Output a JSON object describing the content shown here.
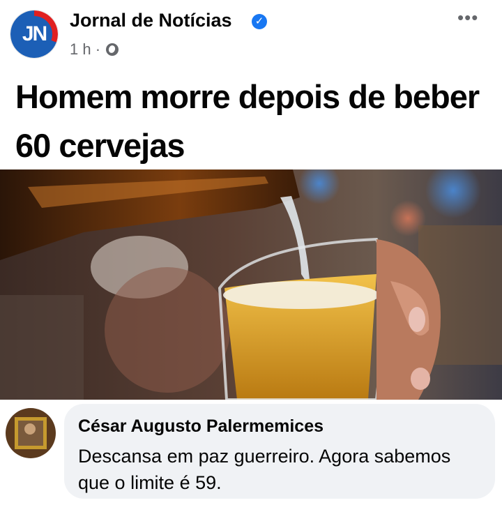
{
  "post": {
    "page_name": "Jornal de Notícias",
    "avatar_text": "JN",
    "verified": true,
    "time": "1 h",
    "separator": "·",
    "audience_icon": "globe-icon",
    "more_icon": "more-horizontal-icon",
    "more_glyph": "•••",
    "text_line1": "Homem morre depois de beber",
    "text_line2": "60 cervejas"
  },
  "photo": {
    "description_icon": "beer-pouring-photo"
  },
  "comment": {
    "author": "César Augusto Palermemices",
    "text": "Descansa em paz guerreiro. Agora sabemos que o limite é 59."
  },
  "colors": {
    "brand_blue": "#1c5fb6",
    "brand_red": "#e02020",
    "verified_blue": "#1877f2",
    "meta_gray": "#65676b",
    "bubble_gray": "#f0f2f5"
  }
}
